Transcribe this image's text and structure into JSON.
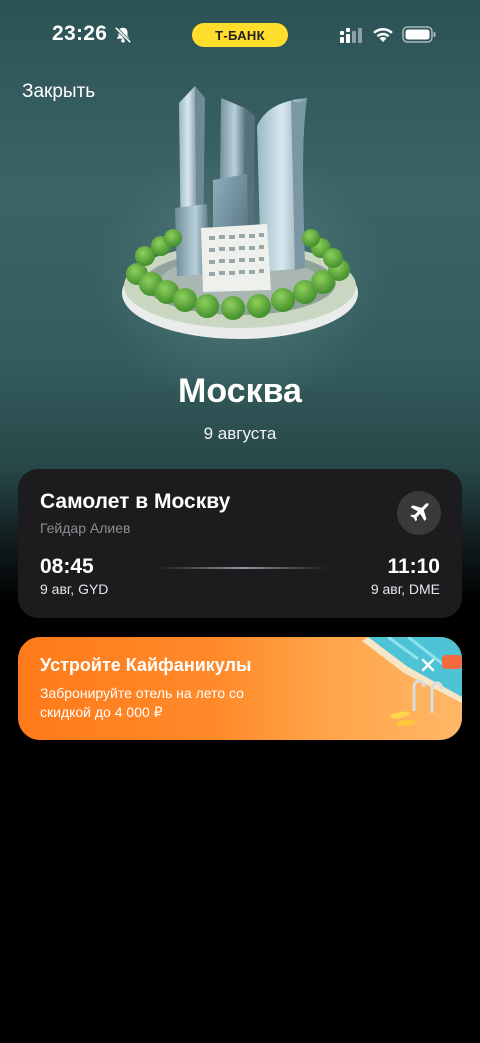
{
  "status_bar": {
    "time": "23:26",
    "bank_label": "Т-БАНК",
    "icons": [
      "bell-slash-icon",
      "signal-icon",
      "wifi-icon",
      "battery-icon"
    ]
  },
  "nav": {
    "close_label": "Закрыть"
  },
  "destination": {
    "city": "Москва",
    "date": "9 августа",
    "illustration": "moscow-city-towers"
  },
  "flight": {
    "title": "Самолет в Москву",
    "airport": "Гейдар Алиев",
    "icon": "airplane-icon",
    "departure": {
      "time": "08:45",
      "info": "9 авг, GYD"
    },
    "arrival": {
      "time": "11:10",
      "info": "9 авг, DME"
    }
  },
  "promo": {
    "title": "Устройте Кайфаникулы",
    "text": "Забронируйте отель на лето со скидкой до 4 000 ₽",
    "icon": "close-icon"
  },
  "colors": {
    "bank_yellow": "#ffdd2d",
    "card_bg": "#1c1c1e",
    "promo_orange": "#ff7a1a",
    "bg_teal": "#3c6466"
  }
}
